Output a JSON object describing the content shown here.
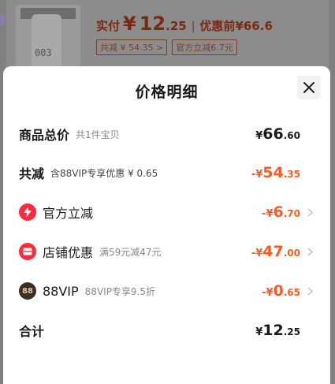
{
  "background": {
    "price_label": "实付",
    "price_currency": "¥",
    "price_int": "12",
    "price_dec": ".25",
    "separator": "|",
    "orig_label": "优惠前",
    "orig_price": "¥66.6",
    "tag_discount": "共减 ¥ 54.35 >",
    "tag_official": "官方立减6.7元",
    "thumb_number": "003"
  },
  "sheet": {
    "title": "价格明细",
    "close_icon": "close-icon"
  },
  "rows": {
    "total_goods": {
      "label": "商品总价",
      "note": "共1件宝贝",
      "currency": "¥",
      "int": "66",
      "dec": ".60"
    },
    "total_discount": {
      "label": "共减",
      "note": "含88VIP专享优惠 ¥ 0.65",
      "currency": "-¥",
      "int": "54",
      "dec": ".35"
    },
    "official_discount": {
      "label": "官方立减",
      "note": "",
      "currency": "-¥",
      "int": "6",
      "dec": ".70",
      "icon": "lightning-icon"
    },
    "store_discount": {
      "label": "店铺优惠",
      "note": "满59元减47元",
      "currency": "-¥",
      "int": "47",
      "dec": ".00",
      "icon": "coupon-icon"
    },
    "vip_discount": {
      "label": "88VIP",
      "note": "88VIP专享9.5折",
      "currency": "-¥",
      "int": "0",
      "dec": ".65",
      "icon": "88vip-icon",
      "badge_text": "88"
    },
    "grand_total": {
      "label": "合计",
      "currency": "¥",
      "int": "12",
      "dec": ".25"
    }
  },
  "colors": {
    "accent_orange": "#ff5a1f",
    "badge_red": "#ff2b3d",
    "vip_dark": "#3a2f26"
  }
}
